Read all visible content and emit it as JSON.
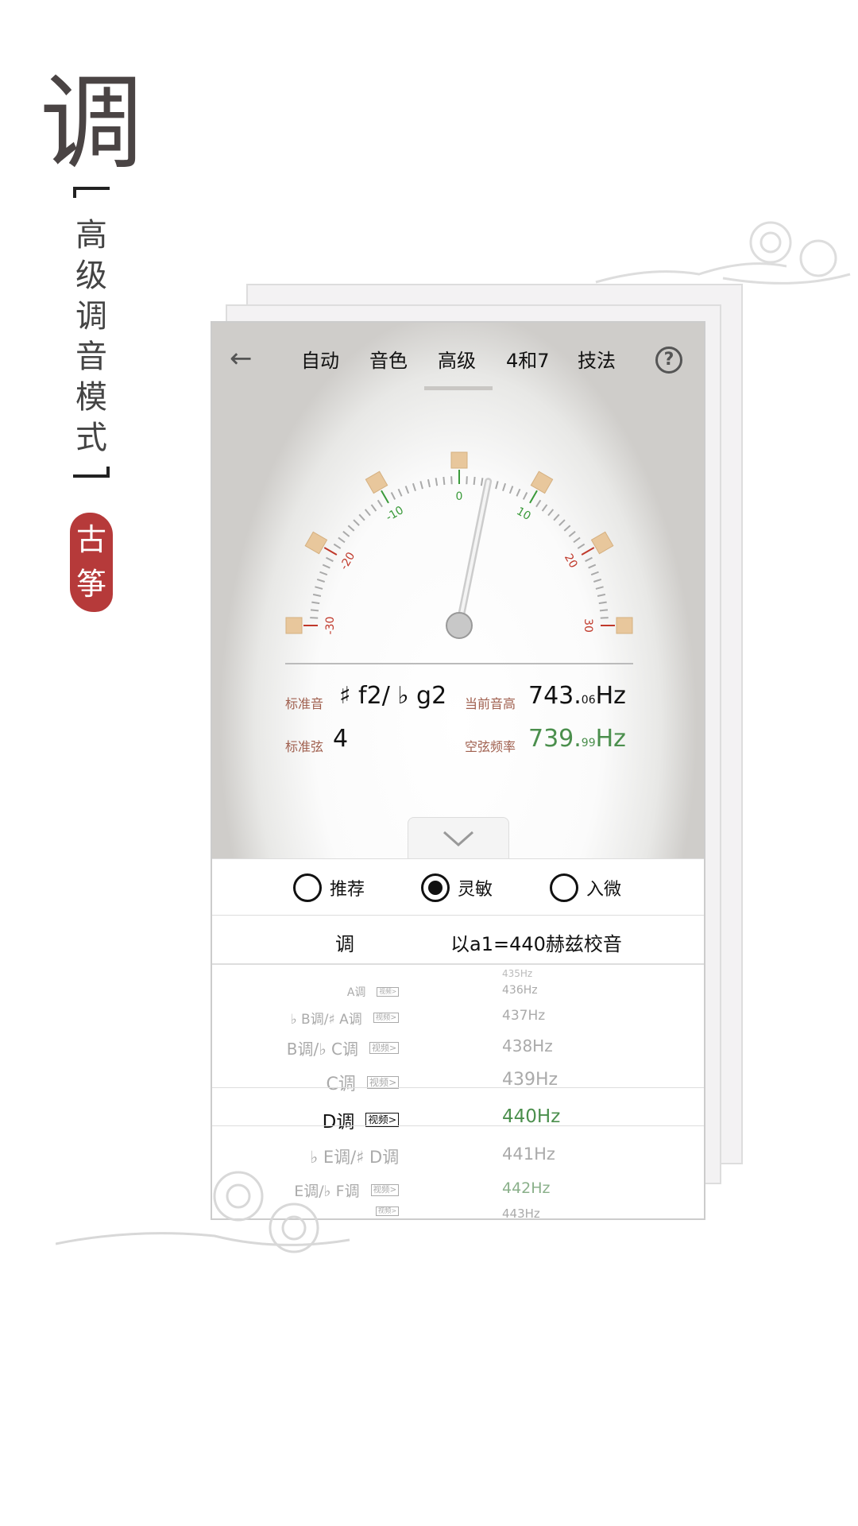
{
  "side": {
    "title_char": "调",
    "vertical_title": [
      "高",
      "级",
      "调",
      "音",
      "模",
      "式"
    ],
    "seal": [
      "古",
      "筝"
    ]
  },
  "nav": {
    "back_icon": "arrow-left-icon",
    "tabs": [
      "自动",
      "音色",
      "高级",
      "4和7",
      "技法"
    ],
    "help_icon": "question-circle-icon"
  },
  "dial": {
    "scale_labels": [
      "-30",
      "-20",
      "-10",
      "0",
      "10",
      "20",
      "30"
    ],
    "needle_cents": 3.8
  },
  "readout": {
    "std_note_label": "标准音",
    "std_note": "♯ f2/ ♭ g2",
    "cur_pitch_label": "当前音高",
    "cur_pitch_int": "743.",
    "cur_pitch_dec": "06",
    "cur_pitch_unit": "Hz",
    "std_string_label": "标准弦",
    "std_string": "4",
    "open_freq_label": "空弦频率",
    "open_freq_int": "739.",
    "open_freq_dec": "99",
    "open_freq_unit": "Hz"
  },
  "expand_icon": "chevron-down-icon",
  "modes": [
    {
      "label": "推荐",
      "selected": false
    },
    {
      "label": "灵敏",
      "selected": true
    },
    {
      "label": "入微",
      "selected": false
    }
  ],
  "table": {
    "col_key": "调",
    "col_ref": "以a1=440赫兹校音",
    "video": "视频",
    "rows": [
      {
        "key": "",
        "hz": "435Hz",
        "video": false
      },
      {
        "key": "A调",
        "hz": "436Hz",
        "video": true
      },
      {
        "key": "♭ B调/♯ A调",
        "hz": "437Hz",
        "video": true
      },
      {
        "key": "B调/♭ C调",
        "hz": "438Hz",
        "video": true
      },
      {
        "key": "C调",
        "hz": "439Hz",
        "video": true
      },
      {
        "key": "D调",
        "hz": "440Hz",
        "video": true,
        "selected": true
      },
      {
        "key": "♭ E调/♯ D调",
        "hz": "441Hz",
        "video": false
      },
      {
        "key": "E调/♭ F调",
        "hz": "442Hz",
        "video": true
      },
      {
        "key": "",
        "hz": "443Hz",
        "video": true
      }
    ]
  },
  "colors": {
    "accent_green": "#4b8f4d",
    "label_brown": "#a0604f",
    "seal_red": "#b63a3a"
  }
}
